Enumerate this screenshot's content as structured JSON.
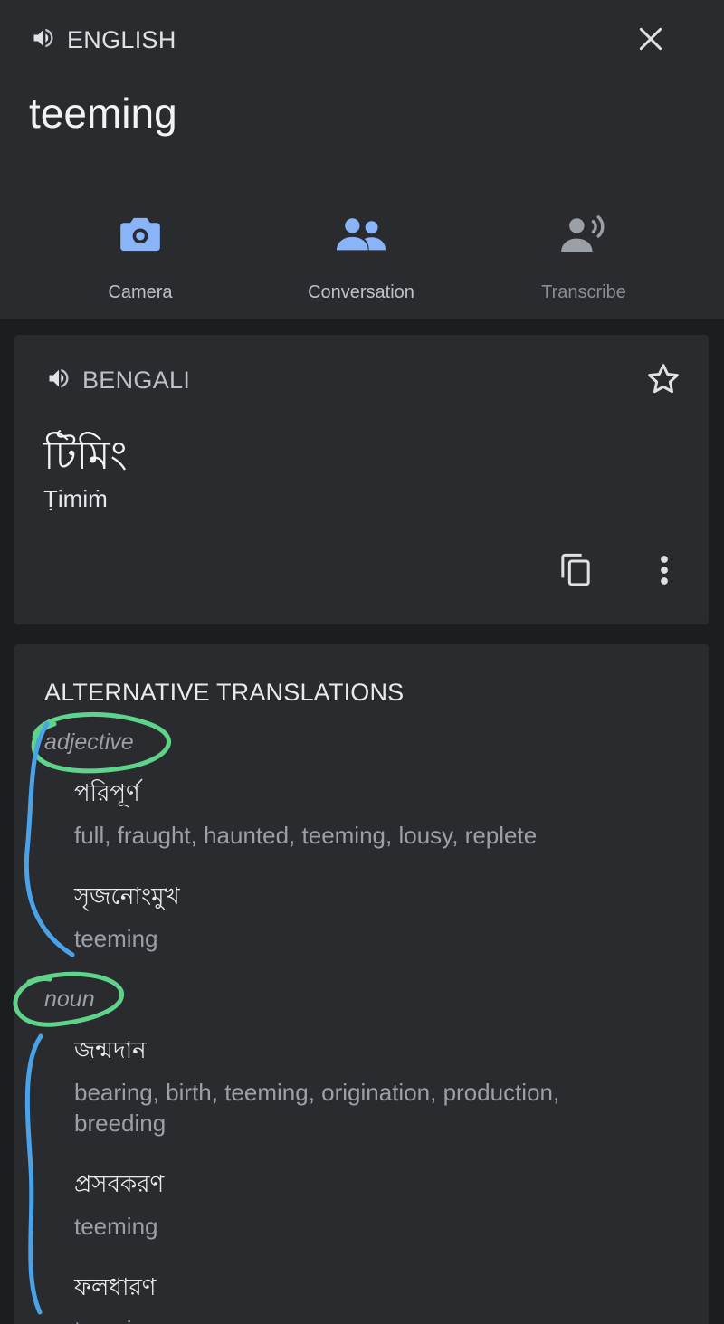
{
  "source": {
    "language_label": "ENGLISH",
    "text": "teeming"
  },
  "modes": [
    {
      "label": "Camera",
      "icon": "camera-icon",
      "color": "#8ab4f8"
    },
    {
      "label": "Conversation",
      "icon": "people-icon",
      "color": "#8ab4f8"
    },
    {
      "label": "Transcribe",
      "icon": "transcribe-icon",
      "color": "#9aa0a6"
    }
  ],
  "result": {
    "language_label": "BENGALI",
    "translation": "টিমিং",
    "transliteration": "Ṭimiṁ"
  },
  "alternatives": {
    "heading": "ALTERNATIVE TRANSLATIONS",
    "groups": [
      {
        "pos": "adjective",
        "entries": [
          {
            "word": "পরিপূর্ণ",
            "gloss": "full, fraught, haunted, teeming, lousy, replete"
          },
          {
            "word": "সৃজনোংমুখ",
            "gloss": "teeming"
          }
        ]
      },
      {
        "pos": "noun",
        "entries": [
          {
            "word": "জন্মদান",
            "gloss": "bearing, birth, teeming, origination, production, breeding"
          },
          {
            "word": "প্রসবকরণ",
            "gloss": "teeming"
          },
          {
            "word": "ফলধারণ",
            "gloss": "teeming"
          }
        ]
      }
    ]
  },
  "colors": {
    "background": "#1c1d20",
    "surface": "#2a2b2f",
    "accent": "#8ab4f8",
    "annotation_green": "#5fd38a",
    "annotation_blue": "#4aa3e8"
  }
}
